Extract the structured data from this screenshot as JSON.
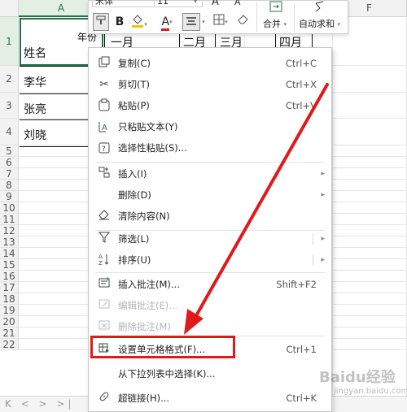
{
  "sheet": {
    "columns": [
      {
        "label": "A",
        "selected": true
      },
      {
        "label": "",
        "selected": false
      },
      {
        "label": "",
        "selected": false
      },
      {
        "label": "",
        "selected": false
      },
      {
        "label": "F",
        "selected": false
      }
    ],
    "rows": [
      "1",
      "2",
      "3",
      "4",
      "5",
      "6",
      "7",
      "8",
      "9",
      "10",
      "11",
      "12",
      "13",
      "14",
      "15",
      "16",
      "17",
      "18",
      "19",
      "20",
      "21",
      "22"
    ],
    "cells": {
      "a1_header": "姓名",
      "a1_year_label": "年份",
      "month1": "一月",
      "month2": "二月",
      "month3": "三月",
      "month4": "四月",
      "a2": "李华",
      "a3": "张亮",
      "a4": "刘晓"
    },
    "bottom_nav": "K < > >|"
  },
  "toolbar": {
    "font_name": "宋体",
    "font_size": "11",
    "font_increase": "A",
    "font_decrease": "A",
    "bold": "B",
    "font_color": "A",
    "merge_label": "合并",
    "autosum_label": "自动求和",
    "colors": {
      "font_color_bar": "#e0191a",
      "fill_color_bar": "#f4c300",
      "accent": "#217346"
    }
  },
  "menu": {
    "items": [
      {
        "icon": "copy-icon",
        "label": "复制(C)",
        "shortcut": "Ctrl+C",
        "disabled": false
      },
      {
        "icon": "scissors-icon",
        "label": "剪切(T)",
        "shortcut": "Ctrl+X",
        "disabled": false
      },
      {
        "icon": "paste-icon",
        "label": "粘贴(P)",
        "shortcut": "Ctrl+V",
        "disabled": false
      },
      {
        "icon": "paste-text-icon",
        "label": "只粘贴文本(Y)",
        "shortcut": "",
        "disabled": false
      },
      {
        "icon": "paste-special-icon",
        "label": "选择性粘贴(S)...",
        "shortcut": "",
        "disabled": false
      },
      {
        "icon": "insert-icon",
        "label": "插入(I)",
        "shortcut": "",
        "disabled": false,
        "submenu": true
      },
      {
        "icon": "",
        "label": "删除(D)",
        "shortcut": "",
        "disabled": false,
        "submenu": true
      },
      {
        "icon": "eraser-icon",
        "label": "清除内容(N)",
        "shortcut": "",
        "disabled": false
      },
      {
        "icon": "filter-icon",
        "label": "筛选(L)",
        "shortcut": "",
        "disabled": false,
        "submenu": true,
        "split": true
      },
      {
        "icon": "sort-icon",
        "label": "排序(U)",
        "shortcut": "",
        "disabled": false,
        "submenu": true,
        "split": true
      },
      {
        "icon": "comment-icon",
        "label": "插入批注(M)...",
        "shortcut": "Shift+F2",
        "disabled": false
      },
      {
        "icon": "edit-comment-icon",
        "label": "编辑批注(E)...",
        "shortcut": "",
        "disabled": true
      },
      {
        "icon": "delete-comment-icon",
        "label": "删除批注(M)",
        "shortcut": "",
        "disabled": true
      },
      {
        "icon": "format-cells-icon",
        "label": "设置单元格格式(F)...",
        "shortcut": "Ctrl+1",
        "disabled": false,
        "highlighted": true
      },
      {
        "icon": "",
        "label": "从下拉列表中选择(K)...",
        "shortcut": "",
        "disabled": false
      },
      {
        "icon": "link-icon",
        "label": "超链接(H)...",
        "shortcut": "Ctrl+K",
        "disabled": false
      }
    ],
    "highlight_color": "#e0191a"
  },
  "annotation": {
    "arrow_color": "#e0191a",
    "watermark": "Baidu经验",
    "watermark_sub": "jingyan.baidu.com"
  }
}
